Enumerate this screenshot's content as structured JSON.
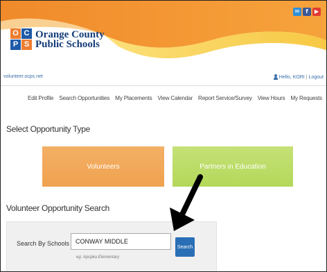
{
  "header": {
    "logo_letters": [
      "O",
      "C",
      "P",
      "S"
    ],
    "logo_line1": "Orange County",
    "logo_line2": "Public Schools",
    "social": [
      {
        "icon": "mail-icon",
        "glyph": "✉"
      },
      {
        "icon": "facebook-icon",
        "glyph": "f"
      },
      {
        "icon": "youtube-icon",
        "glyph": "▶"
      }
    ],
    "colors": {
      "orange": "#f29b38",
      "yellow": "#f8d24a",
      "blue": "#1e5aa8"
    }
  },
  "urlbar": {
    "site": "volunteer.ocps.net",
    "greeting": "Hello, KORI",
    "separator": "|",
    "logout": "Logout"
  },
  "nav": {
    "items": [
      "Edit Profile",
      "Search Opportunities",
      "My Placements",
      "View Calendar",
      "Report Service/Survey",
      "View Hours",
      "My Requests"
    ]
  },
  "opportunity": {
    "title": "Select Opportunity Type",
    "tiles": [
      "Volunteers",
      "Partners in Education"
    ]
  },
  "search": {
    "title": "Volunteer Opportunity Search",
    "label": "Search By Schools",
    "value": "CONWAY MIDDLE",
    "button": "Search",
    "hint": "eg: Apopka Elementary"
  }
}
